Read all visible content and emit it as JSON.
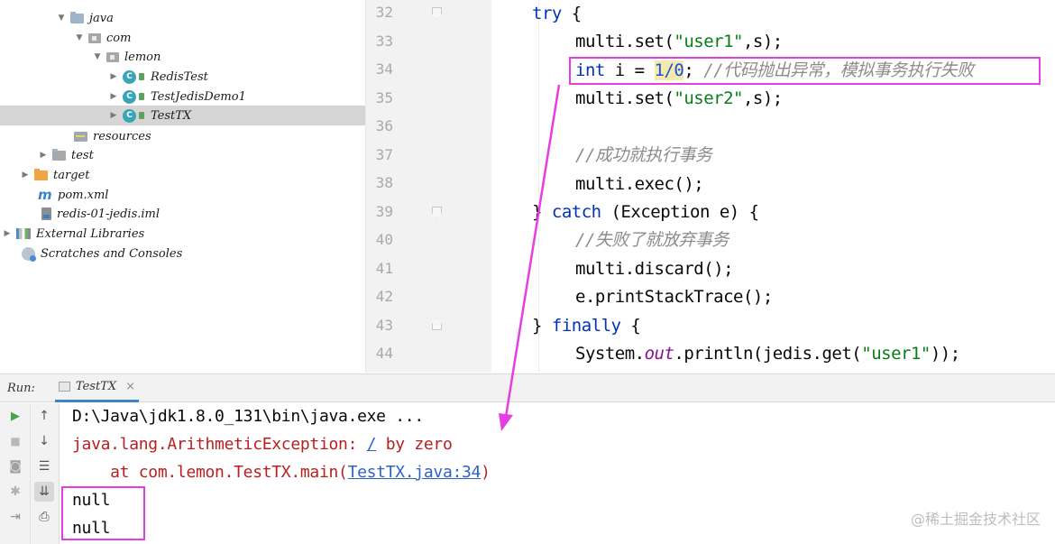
{
  "project_tree": [
    {
      "label": "java",
      "icon": "folder-icon",
      "depth": 1,
      "expanded": true
    },
    {
      "label": "com",
      "icon": "package-icon",
      "depth": 2,
      "expanded": true
    },
    {
      "label": "lemon",
      "icon": "package-icon",
      "depth": 3,
      "expanded": true
    },
    {
      "label": "RedisTest",
      "icon": "java-class-icon",
      "depth": 4,
      "expanded": false
    },
    {
      "label": "TestJedisDemo1",
      "icon": "java-class-icon",
      "depth": 4,
      "expanded": false
    },
    {
      "label": "TestTX",
      "icon": "java-class-icon",
      "depth": 4,
      "expanded": false,
      "selected": true
    },
    {
      "label": "resources",
      "icon": "resources-folder-icon",
      "depth": 1,
      "expanded": null
    },
    {
      "label": "test",
      "icon": "folder-icon",
      "depth": 1,
      "expanded": false
    },
    {
      "label": "target",
      "icon": "excluded-folder-icon",
      "depth": 0,
      "expanded": false
    },
    {
      "label": "pom.xml",
      "icon": "maven-icon",
      "depth": 0,
      "expanded": null
    },
    {
      "label": "redis-01-jedis.iml",
      "icon": "iml-file-icon",
      "depth": 0,
      "expanded": null
    },
    {
      "label": "External Libraries",
      "icon": "libraries-icon",
      "depth": -1,
      "expanded": false
    },
    {
      "label": "Scratches and Consoles",
      "icon": "scratches-icon",
      "depth": -1,
      "expanded": null
    }
  ],
  "editor": {
    "lines": [
      {
        "number": "32",
        "fold": "open"
      },
      {
        "number": "33",
        "fold": ""
      },
      {
        "number": "34",
        "fold": ""
      },
      {
        "number": "35",
        "fold": ""
      },
      {
        "number": "36",
        "fold": ""
      },
      {
        "number": "37",
        "fold": ""
      },
      {
        "number": "38",
        "fold": ""
      },
      {
        "number": "39",
        "fold": "open"
      },
      {
        "number": "40",
        "fold": ""
      },
      {
        "number": "41",
        "fold": ""
      },
      {
        "number": "42",
        "fold": ""
      },
      {
        "number": "43",
        "fold": "close"
      },
      {
        "number": "44",
        "fold": ""
      }
    ],
    "code": {
      "l32_kw": "try",
      "l32_rest": " {",
      "l33_a": "multi.set(",
      "l33_s": "\"user1\"",
      "l33_b": ",s);",
      "l34_kw": "int",
      "l34_a": " i = ",
      "l34_num": "1/0",
      "l34_b": "; ",
      "l34_cm": "//代码抛出异常，模拟事务执行失败",
      "l35_a": "multi.set(",
      "l35_s": "\"user2\"",
      "l35_b": ",s);",
      "l37_cm": "//成功就执行事务",
      "l38": "multi.exec();",
      "l39_a": "} ",
      "l39_kw": "catch",
      "l39_b": " (Exception e) {",
      "l40_cm": "//失败了就放弃事务",
      "l41": "multi.discard();",
      "l42": "e.printStackTrace();",
      "l43_a": "} ",
      "l43_kw": "finally",
      "l43_b": " {",
      "l44_a": "System.",
      "l44_field": "out",
      "l44_b": ".println(jedis.get(",
      "l44_s": "\"user1\"",
      "l44_c": "));"
    }
  },
  "run_window": {
    "label": "Run:",
    "tab_title": "TestTX",
    "tab_close": "×",
    "left_toolbar": [
      "run-icon",
      "stop-icon",
      "camera-icon",
      "settings-icon",
      "login-icon"
    ],
    "right_toolbar": [
      "up-arrow-icon",
      "down-arrow-icon",
      "soft-wrap-icon",
      "scroll-to-end-icon",
      "print-icon"
    ]
  },
  "console": {
    "command": "D:\\Java\\jdk1.8.0_131\\bin\\java.exe ...",
    "exception_prefix": "java.lang.ArithmeticException: ",
    "exception_link": "/",
    "exception_suffix": " by zero",
    "stack_prefix": "    at com.lemon.TestTX.main(",
    "stack_link": "TestTX.java:34",
    "stack_suffix": ")",
    "output": [
      "null",
      "null"
    ]
  },
  "watermark": "@稀土掘金技术社区",
  "colors": {
    "keyword": "#0033b3",
    "string": "#067d17",
    "comment": "#8c8c8c",
    "number": "#1750eb",
    "error": "#b82020",
    "annotation": "#e53ee5"
  }
}
